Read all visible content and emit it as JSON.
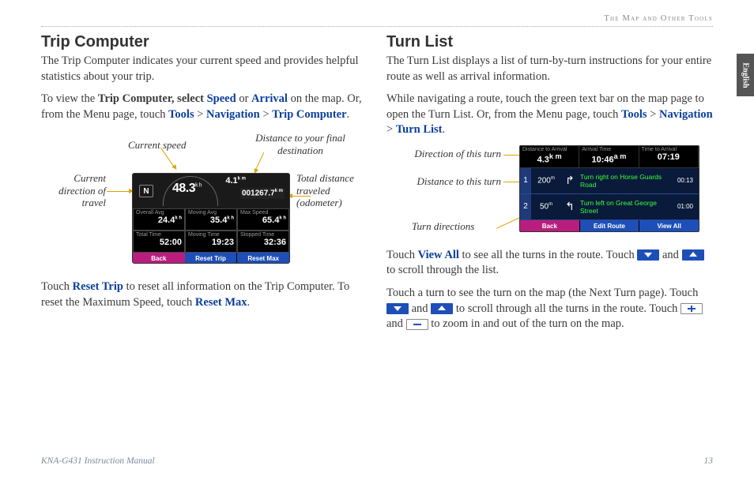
{
  "header": {
    "section": "The Map and Other Tools"
  },
  "tab": {
    "label": "English"
  },
  "footer": {
    "left": "KNA-G431 Instruction Manual",
    "page": "13"
  },
  "left": {
    "title": "Trip Computer",
    "p1": "The Trip Computer indicates your current speed and provides helpful statistics about your trip.",
    "p2a": "To view the ",
    "p2b": "Trip Computer, select ",
    "p2c": "Speed",
    "p2d": " or ",
    "p2e": "Arrival",
    "p2f": " on the map. Or, from the Menu page, touch ",
    "p2g": "Tools",
    "p2h": " > ",
    "p2i": "Navigation",
    "p2j": " > ",
    "p2k": "Trip Computer",
    "p2l": ".",
    "labels": {
      "curspd": "Current speed",
      "dist_final": "Distance to your final destination",
      "curdir": "Current direction of travel",
      "odo": "Total distance traveled (odometer)"
    },
    "device": {
      "dir": "N",
      "speed": "48.3",
      "speed_u": "k h",
      "dist_top": "4.1",
      "dist_u": "k m",
      "odo": "001267.7",
      "odo_u": "k m",
      "stats": {
        "oa_l": "Overall Avg",
        "oa": "24.4",
        "oa_u": "k h",
        "ma_l": "Moving Avg",
        "ma": "35.4",
        "ma_u": "k h",
        "ms_l": "Max Speed",
        "ms": "65.4",
        "ms_u": "k h",
        "tt_l": "Total Time",
        "tt": "52:00",
        "mt_l": "Moving Time",
        "mt": "19:23",
        "st_l": "Stopped Time",
        "st": "32:36"
      },
      "btns": {
        "back": "Back",
        "rt": "Reset Trip",
        "rm": "Reset Max"
      }
    },
    "p3a": "Touch ",
    "p3b": "Reset Trip",
    "p3c": " to reset all information on the Trip Computer. To reset the Maximum Speed, touch ",
    "p3d": "Reset Max",
    "p3e": "."
  },
  "right": {
    "title": "Turn List",
    "p1": "The Turn List displays a list of turn-by-turn instructions for your entire route as well as arrival information.",
    "p2a": "While navigating a route, touch the green text bar on the map page to open the Turn List. Or, from the Menu page, touch ",
    "p2b": "Tools",
    "p2c": " > ",
    "p2d": "Navigation",
    "p2e": " > ",
    "p2f": "Turn List",
    "p2g": ".",
    "labels": {
      "dir": "Direction of this turn",
      "dist": "Distance to this turn",
      "td": "Turn directions"
    },
    "device": {
      "h1l": "Distance to Arrival",
      "h1v": "4.3",
      "h1u": "k m",
      "h2l": "Arrival Time",
      "h2v": "10:46",
      "h2u": "a m",
      "h3l": "Time to Arrival",
      "h3v": "07:19",
      "r1_i": "1",
      "r1_d": "200",
      "r1_du": "m",
      "r1_t": "Turn right on Horse Guards Road",
      "r1_tm": "00:13",
      "r2_i": "2",
      "r2_d": "50",
      "r2_du": "m",
      "r2_t": "Turn left on Great George Street",
      "r2_tm": "01:00",
      "btns": {
        "back": "Back",
        "er": "Edit Route",
        "va": "View All"
      }
    },
    "p3a": "Touch ",
    "p3b": "View All",
    "p3c": " to see all the turns in the route. Touch ",
    "p3d": " and ",
    "p3e": " to scroll through the list.",
    "p4a": "Touch a turn to see the turn on the map (the Next Turn page). Touch ",
    "p4b": " and ",
    "p4c": " to scroll through all the turns in the route. Touch ",
    "p4d": " and ",
    "p4e": " to zoom in and out of the turn on the map."
  }
}
